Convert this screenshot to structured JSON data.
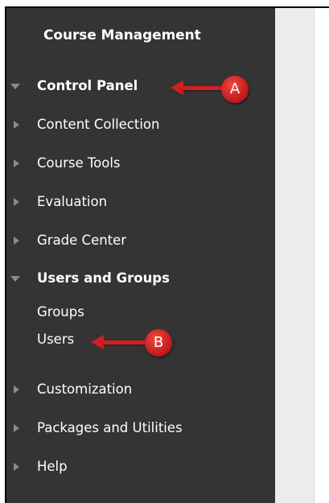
{
  "sidebar": {
    "title": "Course Management",
    "items": [
      {
        "label": "Control Panel",
        "state": "expanded"
      },
      {
        "label": "Content Collection",
        "state": "collapsed"
      },
      {
        "label": "Course Tools",
        "state": "collapsed"
      },
      {
        "label": "Evaluation",
        "state": "collapsed"
      },
      {
        "label": "Grade Center",
        "state": "collapsed"
      },
      {
        "label": "Users and Groups",
        "state": "expanded"
      },
      {
        "label": "Customization",
        "state": "collapsed"
      },
      {
        "label": "Packages and Utilities",
        "state": "collapsed"
      },
      {
        "label": "Help",
        "state": "collapsed"
      }
    ],
    "users_and_groups_children": [
      "Groups",
      "Users"
    ]
  },
  "annotations": {
    "a": "A",
    "b": "B",
    "color": "#d31f22"
  },
  "icons": {
    "expanded": "caret-down-icon",
    "collapsed": "caret-right-icon"
  }
}
